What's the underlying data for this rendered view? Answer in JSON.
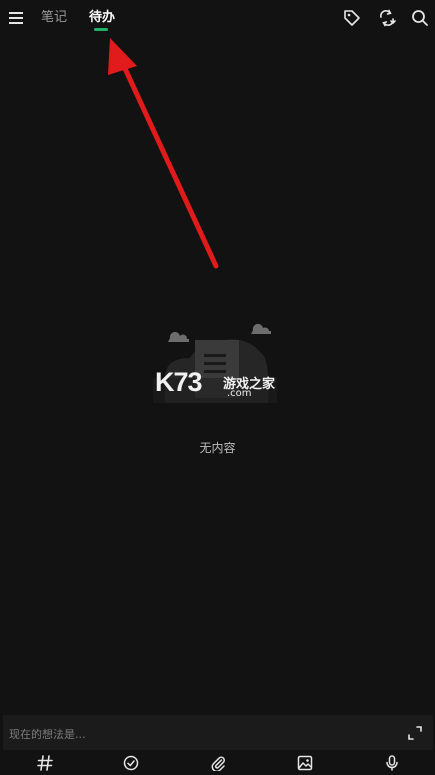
{
  "topbar": {
    "menu_icon": "hamburger-menu-icon",
    "tabs": [
      {
        "label": "笔记",
        "active": false
      },
      {
        "label": "待办",
        "active": true
      }
    ],
    "right_icons": [
      "tag-icon",
      "sync-icon",
      "search-icon"
    ]
  },
  "empty_state": {
    "text": "无内容"
  },
  "watermark": {
    "main": "K73",
    "cn": "游戏之家",
    "domain": ".com"
  },
  "input": {
    "placeholder": "现在的想法是..."
  },
  "toolbar": {
    "icons": [
      "hashtag-icon",
      "check-circle-icon",
      "attachment-icon",
      "image-icon",
      "microphone-icon"
    ]
  },
  "colors": {
    "background": "#121212",
    "accent": "#1fb36a",
    "annotation_arrow": "#e11b1b"
  }
}
